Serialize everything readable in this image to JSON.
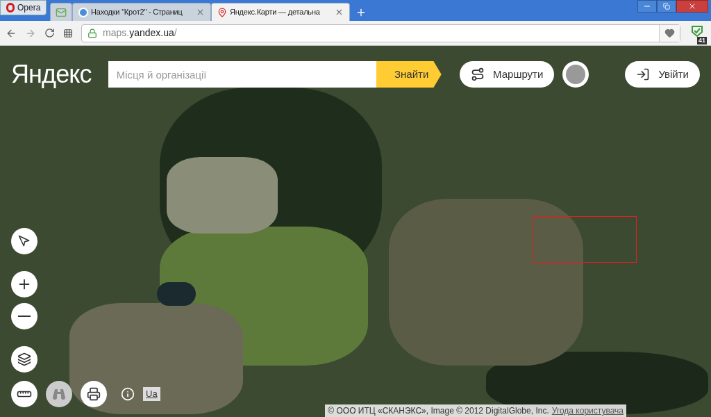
{
  "browser": {
    "menu_button": "Opera",
    "tabs": [
      {
        "kind": "mail",
        "selected": false
      },
      {
        "kind": "page",
        "title": "Находки \"Крот2\" - Страниц",
        "selected": false
      },
      {
        "kind": "maps",
        "title": "Яндекс.Карти — детальна",
        "selected": true
      }
    ],
    "address": {
      "host_prefix": "maps.",
      "host": "yandex.ua",
      "path": "/"
    },
    "extension_badge": "41"
  },
  "map": {
    "logo": "Яндекс",
    "search": {
      "placeholder": "Місця й організації",
      "button": "Знайти"
    },
    "routes_button": "Маршрути",
    "login_button": "Увійти",
    "language": "Ua",
    "copyright": "© ООО ИТЦ «СКАНЭКС», Image © 2012 DigitalGlobe, Inc.",
    "terms_link": "Угода користувача"
  }
}
